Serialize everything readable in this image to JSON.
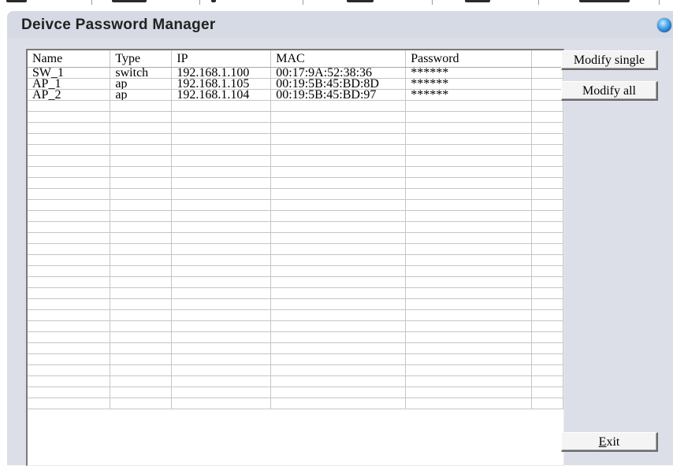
{
  "window": {
    "title": "Deivce Password Manager"
  },
  "table": {
    "columns": [
      "Name",
      "Type",
      "IP",
      "MAC",
      "Password",
      ""
    ],
    "rows": [
      {
        "name": "SW_1",
        "type": "switch",
        "ip": "192.168.1.100",
        "mac": "00:17:9A:52:38:36",
        "password": "******"
      },
      {
        "name": "AP_1",
        "type": "ap",
        "ip": "192.168.1.105",
        "mac": "00:19:5B:45:BD:8D",
        "password": "******"
      },
      {
        "name": "AP_2",
        "type": "ap",
        "ip": "192.168.1.104",
        "mac": "00:19:5B:45:BD:97",
        "password": "******"
      }
    ]
  },
  "buttons": {
    "modify_single": "Modify single",
    "modify_all": "Modify all",
    "exit_mnemonic": "E",
    "exit_rest": "xit"
  },
  "colors": {
    "window_bg": "#dcdfe8",
    "grid_line": "#c6c6c6",
    "orb": "#1868c0"
  },
  "icons": {
    "title_orb": "blue-orb-icon"
  }
}
